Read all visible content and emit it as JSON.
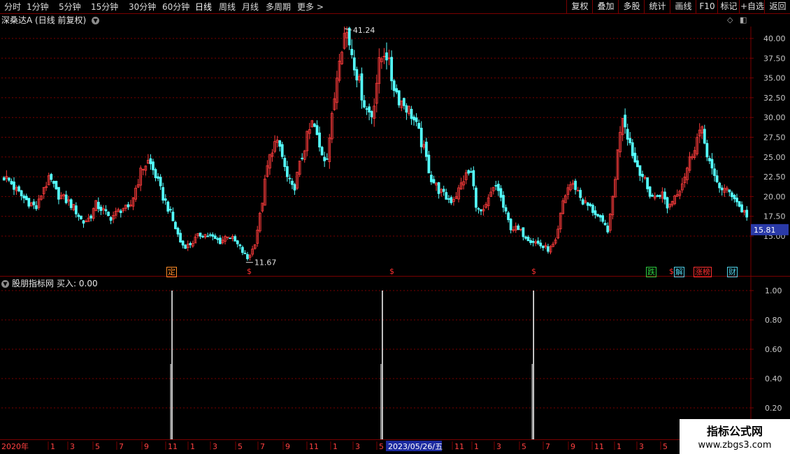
{
  "toolbar": {
    "tabs": [
      "分时",
      "1分钟",
      "5分钟",
      "15分钟",
      "30分钟",
      "60分钟",
      "日线",
      "周线",
      "月线",
      "多周期",
      "更多"
    ],
    "active_tab": "日线",
    "buttons": [
      "复权",
      "叠加",
      "多股",
      "统计",
      "画线",
      "F10",
      "标记",
      "+自选",
      "返回"
    ]
  },
  "main_chart": {
    "stock_name": "深桑达A",
    "period_label": "(日线 前复权)",
    "high_label": "41.24",
    "low_label": "11.67",
    "current_price": "15.81",
    "y_ticks": [
      "40.00",
      "37.50",
      "35.00",
      "32.50",
      "30.00",
      "27.50",
      "25.00",
      "22.50",
      "20.00",
      "17.50",
      "15.00"
    ],
    "event_markers": [
      {
        "text": "定",
        "color": "#ff8c28"
      },
      {
        "text": "$",
        "color": "#ff3030"
      },
      {
        "text": "$",
        "color": "#ff3030"
      },
      {
        "text": "$",
        "color": "#ff3030"
      },
      {
        "text": "跌",
        "color": "#2ecc40"
      },
      {
        "text": "$",
        "color": "#ff3030"
      },
      {
        "text": "解",
        "color": "#4fd0e8"
      },
      {
        "text": "涨榜",
        "color": "#ff3030"
      },
      {
        "text": "财",
        "color": "#4fd0e8"
      }
    ]
  },
  "indicator": {
    "name": "股朋指标网",
    "label": "买入: 0.00",
    "y_ticks": [
      "1.00",
      "0.80",
      "0.60",
      "0.40",
      "0.20"
    ]
  },
  "x_axis": {
    "start_label": "2020年",
    "month_labels": [
      "1",
      "3",
      "5",
      "7",
      "9",
      "11",
      "1",
      "3",
      "5",
      "7",
      "9",
      "11",
      "1",
      "3",
      "5",
      "11",
      "1",
      "3",
      "5",
      "7",
      "9",
      "11",
      "1",
      "3",
      "5"
    ],
    "cursor_date": "2023/05/26/五"
  },
  "watermark": {
    "line1": "指标公式网",
    "line2": "www.zbgs3.com"
  },
  "colors": {
    "up": "#ff3c3c",
    "down": "#54ffff",
    "grid": "#7a0000",
    "price_tag_bg": "#2a3aa8"
  },
  "chart_data": {
    "type": "candlestick",
    "close_series": [
      22.5,
      21.8,
      20.6,
      19.8,
      19.2,
      18.5,
      21.2,
      22.2,
      20.4,
      19.8,
      19.2,
      18.1,
      16.7,
      17.3,
      19.0,
      18.3,
      17.3,
      17.8,
      18.6,
      18.2,
      21.0,
      23.6,
      24.5,
      22.8,
      20.3,
      18.5,
      16.2,
      13.9,
      13.8,
      14.5,
      15.3,
      15.1,
      14.6,
      14.3,
      15.2,
      14.4,
      13.4,
      12.1,
      13.6,
      17.8,
      23.5,
      26.8,
      26.2,
      22.5,
      20.7,
      24.0,
      27.2,
      29.5,
      26.1,
      24.6,
      30.5,
      38.2,
      41.2,
      38.0,
      34.4,
      31.2,
      30.3,
      36.5,
      38.8,
      34.8,
      32.5,
      31.6,
      30.4,
      28.2,
      25.5,
      22.3,
      21.0,
      20.0,
      19.5,
      20.5,
      22.4,
      23.2,
      18.2,
      17.9,
      20.2,
      21.5,
      18.5,
      16.2,
      15.8,
      15.3,
      14.6,
      14.2,
      13.6,
      13.3,
      14.2,
      19.3,
      21.6,
      21.2,
      19.4,
      18.7,
      17.9,
      16.5,
      15.8,
      22.8,
      30.8,
      27.5,
      24.4,
      23.0,
      20.6,
      19.8,
      20.6,
      18.6,
      20.1,
      21.5,
      23.8,
      26.4,
      28.6,
      25.5,
      22.2,
      21.2,
      20.6,
      20.2,
      18.5,
      17.7
    ],
    "indicator_series": [
      {
        "name": "买入",
        "spike_dates_index": [
          25,
          57,
          80
        ],
        "value": 1.0
      }
    ],
    "ylim": [
      11,
      42
    ],
    "indicator_ylim": [
      0,
      1.05
    ]
  }
}
